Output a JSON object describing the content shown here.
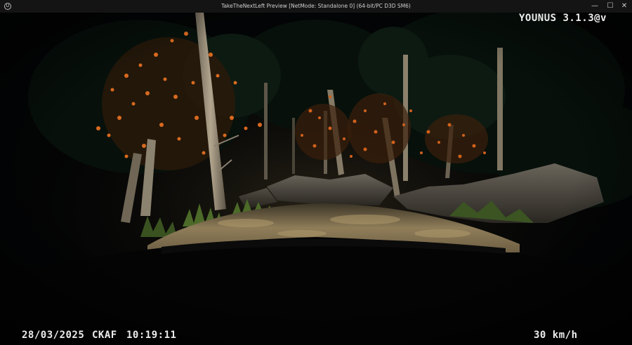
{
  "window": {
    "title": "TakeTheNextLeft Preview [NetMode: Standalone 0]  (64-bit/PC D3D SM6)",
    "logo_icon": "unreal-logo-icon",
    "controls": {
      "minimize": "—",
      "maximize": "☐",
      "close": "✕"
    }
  },
  "hud": {
    "version": "YOUNUS 3.1.3@v",
    "date": "28/03/2025",
    "code": "CKAF",
    "time": "10:19:11",
    "speed": "30 km/h"
  },
  "scene": {
    "description_colors": {
      "sky": "#050608",
      "foliage_dark": "#0d1a12",
      "leaves_orange": "#d8641c",
      "road_lit": "#8a7a58",
      "hood": "#050505",
      "grass": "#4f6b2a"
    }
  }
}
